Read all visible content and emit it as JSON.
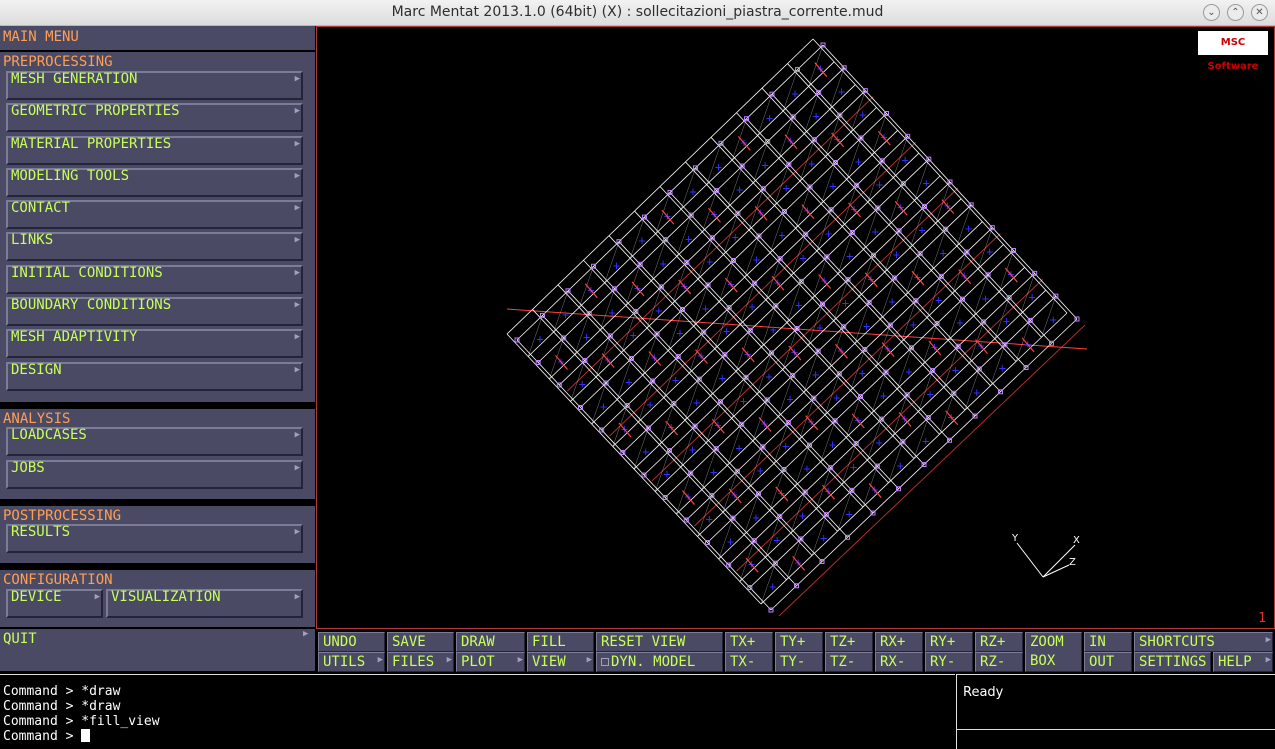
{
  "window": {
    "title": "Marc Mentat 2013.1.0 (64bit) (X) : sollecitazioni_piastra_corrente.mud"
  },
  "menu": {
    "main_menu": "MAIN MENU",
    "preprocessing": "PREPROCESSING",
    "pre_items": [
      "MESH GENERATION",
      "GEOMETRIC PROPERTIES",
      "MATERIAL PROPERTIES",
      "MODELING TOOLS",
      "CONTACT",
      "LINKS",
      "INITIAL CONDITIONS",
      "BOUNDARY CONDITIONS",
      "MESH ADAPTIVITY",
      "DESIGN"
    ],
    "analysis": "ANALYSIS",
    "analysis_items": [
      "LOADCASES",
      "JOBS"
    ],
    "postprocessing": "POSTPROCESSING",
    "post_items": [
      "RESULTS"
    ],
    "configuration": "CONFIGURATION",
    "config_items": [
      "DEVICE",
      "VISUALIZATION"
    ],
    "quit": "QUIT"
  },
  "viewport": {
    "logo": "MSC Software",
    "viewport_number": "1",
    "axes": {
      "y": "Y",
      "x": "X",
      "z": "Z"
    }
  },
  "toolbar": {
    "undo": "UNDO",
    "save": "SAVE",
    "draw": "DRAW",
    "fill": "FILL",
    "reset_view": "RESET VIEW",
    "tx_plus": "TX+",
    "ty_plus": "TY+",
    "tz_plus": "TZ+",
    "rx_plus": "RX+",
    "ry_plus": "RY+",
    "rz_plus": "RZ+",
    "zoom_box": "ZOOM BOX",
    "in": "IN",
    "shortcuts": "SHORTCUTS",
    "utils": "UTILS",
    "files": "FILES",
    "plot": "PLOT",
    "view": "VIEW",
    "dyn_model": "DYN. MODEL",
    "tx_minus": "TX-",
    "ty_minus": "TY-",
    "tz_minus": "TZ-",
    "rx_minus": "RX-",
    "ry_minus": "RY-",
    "rz_minus": "RZ-",
    "out": "OUT",
    "settings": "SETTINGS",
    "help": "HELP"
  },
  "command": {
    "history": [
      "Command > *draw",
      "Command > *draw",
      "Command > *fill_view"
    ],
    "prompt": "Command > "
  },
  "status": {
    "text": "Ready"
  },
  "colors": {
    "menu_bg": "#4a4a64",
    "button_text": "#c8ff5a",
    "header_text": "#ff9f55",
    "mesh_lines": "#ffffff",
    "nodes": "#c080ff",
    "boundary_arrows": "#ff4040",
    "element_markers": "#3030ff"
  }
}
